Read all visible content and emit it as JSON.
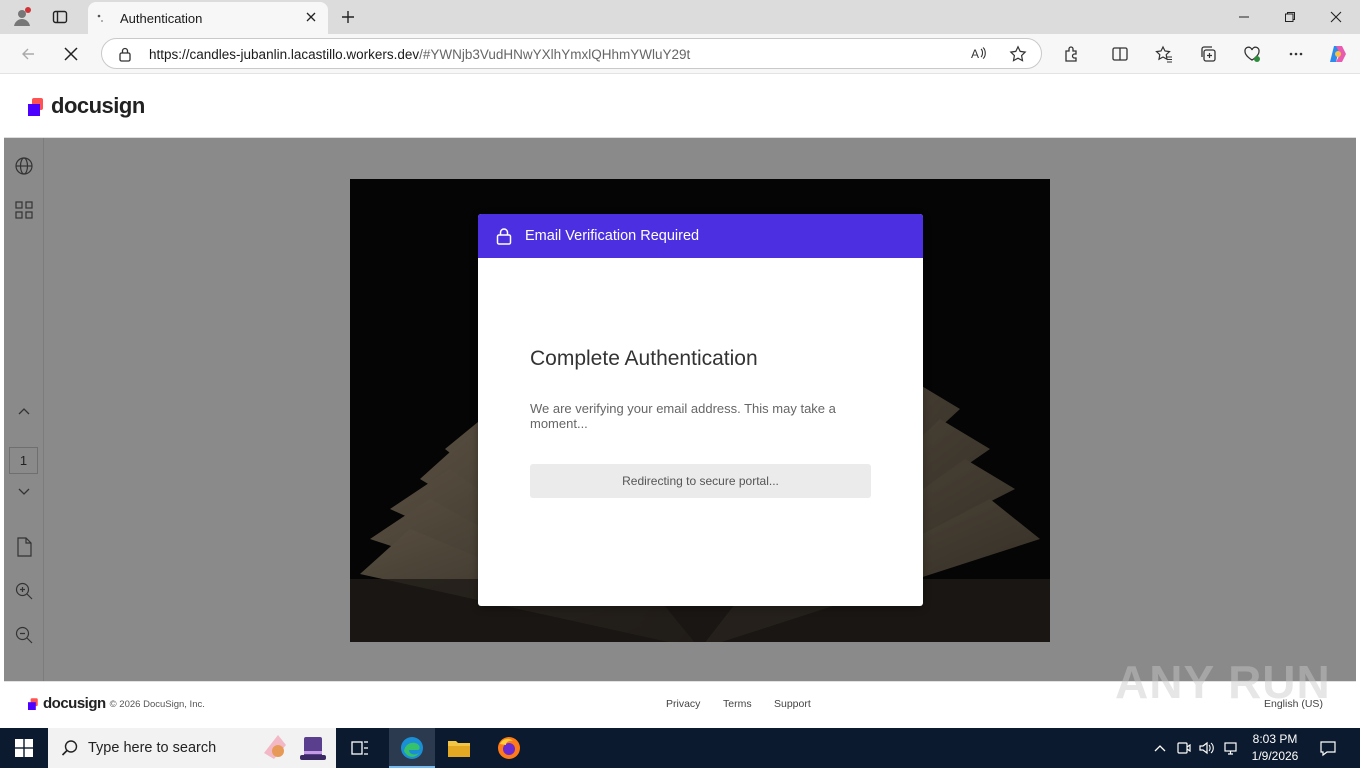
{
  "browser": {
    "tab_title": "Authentication",
    "url_host": "https://candles-jubanlin.lacastillo.workers.dev",
    "url_path": "/#YWNjb3VudHNwYXlhYmxlQHhmYWluY29t"
  },
  "header": {
    "logo_text": "docusign"
  },
  "viewer": {
    "page_number": "1"
  },
  "dialog": {
    "title": "Email Verification Required",
    "heading": "Complete Authentication",
    "message": "We are verifying your email address. This may take a moment...",
    "status": "Redirecting to secure portal...",
    "accent_color": "#4c2fe0"
  },
  "footer": {
    "logo_text": "docusign",
    "copyright": "© 2026 DocuSign, Inc.",
    "links": [
      "Privacy",
      "Terms",
      "Support"
    ],
    "language": "English (US)"
  },
  "watermark": "ANY RUN",
  "taskbar": {
    "search_placeholder": "Type here to search",
    "time": "8:03 PM",
    "date": "1/9/2026"
  }
}
